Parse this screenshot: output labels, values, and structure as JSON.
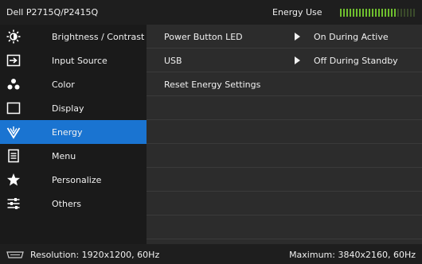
{
  "header": {
    "model": "Dell P2715Q/P2415Q",
    "energy_use_label": "Energy Use",
    "energy_level": 0.75
  },
  "menu": {
    "items": [
      {
        "label": "Brightness / Contrast",
        "icon": "brightness-icon"
      },
      {
        "label": "Input Source",
        "icon": "input-source-icon"
      },
      {
        "label": "Color",
        "icon": "color-icon"
      },
      {
        "label": "Display",
        "icon": "display-icon"
      },
      {
        "label": "Energy",
        "icon": "energy-icon",
        "selected": true
      },
      {
        "label": "Menu",
        "icon": "menu-icon"
      },
      {
        "label": "Personalize",
        "icon": "star-icon"
      },
      {
        "label": "Others",
        "icon": "others-icon"
      }
    ]
  },
  "content": {
    "rows": [
      {
        "label": "Power Button LED",
        "value": "On During Active"
      },
      {
        "label": "USB",
        "value": "Off During Standby"
      },
      {
        "label": "Reset Energy Settings",
        "value": ""
      }
    ]
  },
  "footer": {
    "resolution": "Resolution: 1920x1200, 60Hz",
    "maximum": "Maximum: 3840x2160, 60Hz"
  },
  "colors": {
    "accent": "#1a74d1",
    "energy_green": "#6fbf2e"
  }
}
